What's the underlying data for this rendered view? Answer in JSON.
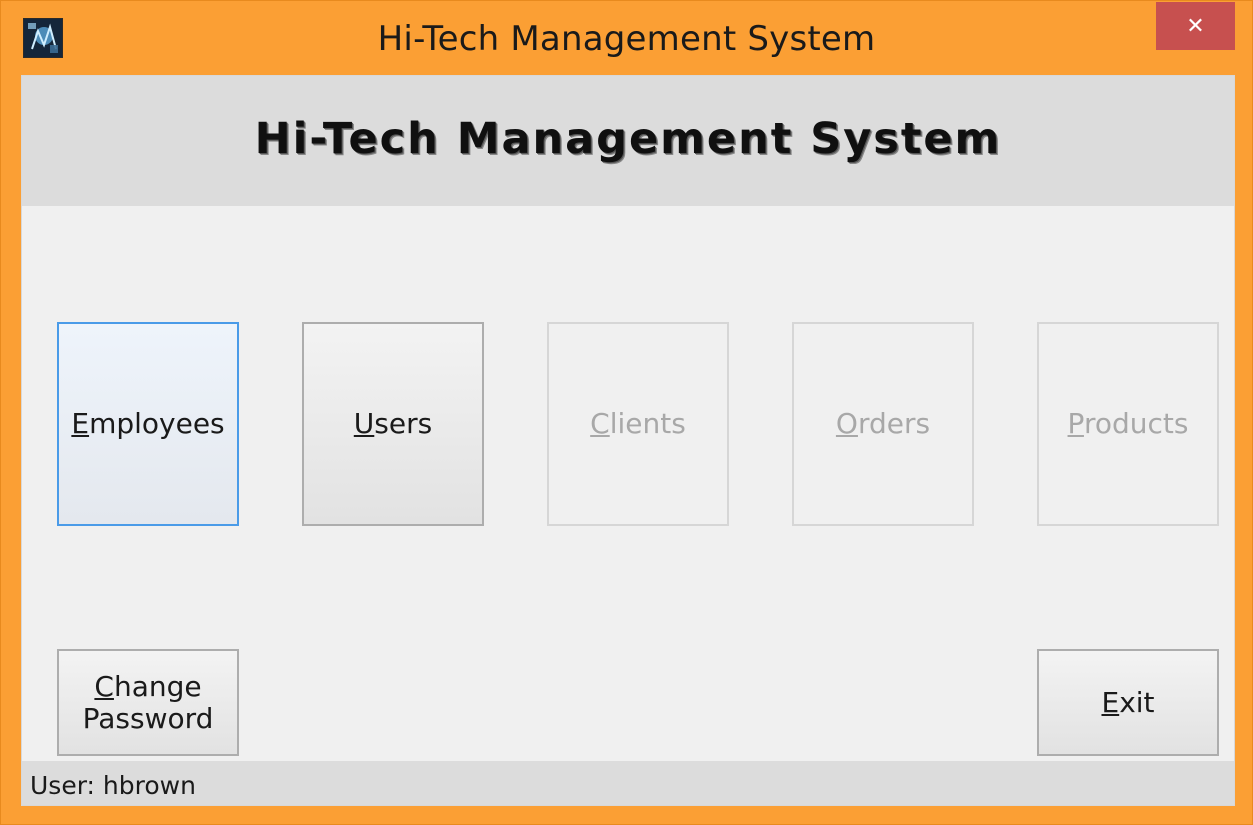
{
  "window": {
    "title": "Hi-Tech Management System",
    "close_symbol": "✕",
    "accent_color": "#fb9f34",
    "close_color": "#c7504f"
  },
  "header": {
    "title": "Hi-Tech Management System"
  },
  "buttons": {
    "employees": "Employees",
    "users": "Users",
    "clients": "Clients",
    "orders": "Orders",
    "products": "Products",
    "change_password": "Change Password",
    "exit": "Exit"
  },
  "status": {
    "text": "User: hbrown"
  },
  "icons": {
    "app": "app-logo-icon",
    "close": "close-icon"
  }
}
